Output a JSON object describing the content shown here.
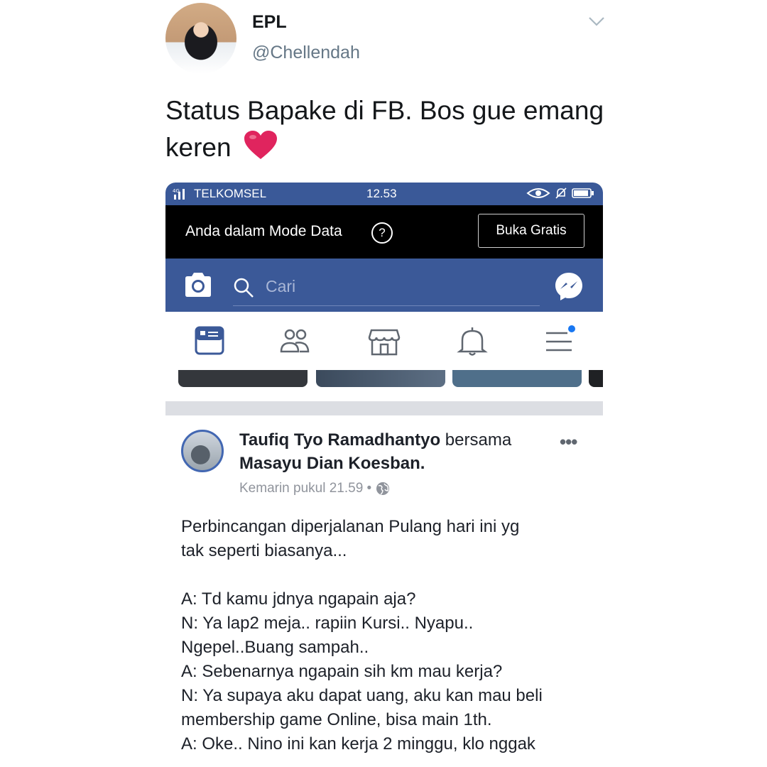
{
  "tweet": {
    "name": "EPL",
    "handle": "@Chellendah",
    "text": "Status Bapake di FB. Bos gue emang keren",
    "heart": "heart-icon",
    "menu": "chevron-down-icon"
  },
  "phone": {
    "statusbar": {
      "carrier": "TELKOMSEL",
      "signal": "4G",
      "time": "12.53"
    },
    "databar": {
      "text": "Anda dalam Mode Data",
      "help": "?",
      "button": "Buka Gratis"
    },
    "header": {
      "search_placeholder": "Cari"
    },
    "nav": [
      "news-feed-icon",
      "friends-icon",
      "marketplace-icon",
      "notifications-icon",
      "menu-icon"
    ],
    "post": {
      "author": "Taufiq Tyo Ramadhantyo",
      "with_word": "bersama",
      "tagged": "Masayu Dian Koesban.",
      "timestamp": "Kemarin pukul 21.59 •",
      "more": "•••",
      "body": [
        "Perbincangan diperjalanan Pulang hari ini yg",
        "tak seperti biasanya...",
        "",
        "A: Td kamu jdnya ngapain aja?",
        "N: Ya lap2 meja.. rapiin Kursi.. Nyapu..",
        "Ngepel..Buang sampah..",
        "A: Sebenarnya ngapain sih km mau kerja?",
        "N: Ya supaya aku dapat uang, aku kan mau beli",
        "membership game Online, bisa main 1th.",
        "A: Oke.. Nino ini kan kerja 2 minggu, klo nggak"
      ]
    }
  },
  "colors": {
    "fb_blue": "#3b5998",
    "notification_dot": "#1877f2",
    "heart": "#e0245e"
  }
}
